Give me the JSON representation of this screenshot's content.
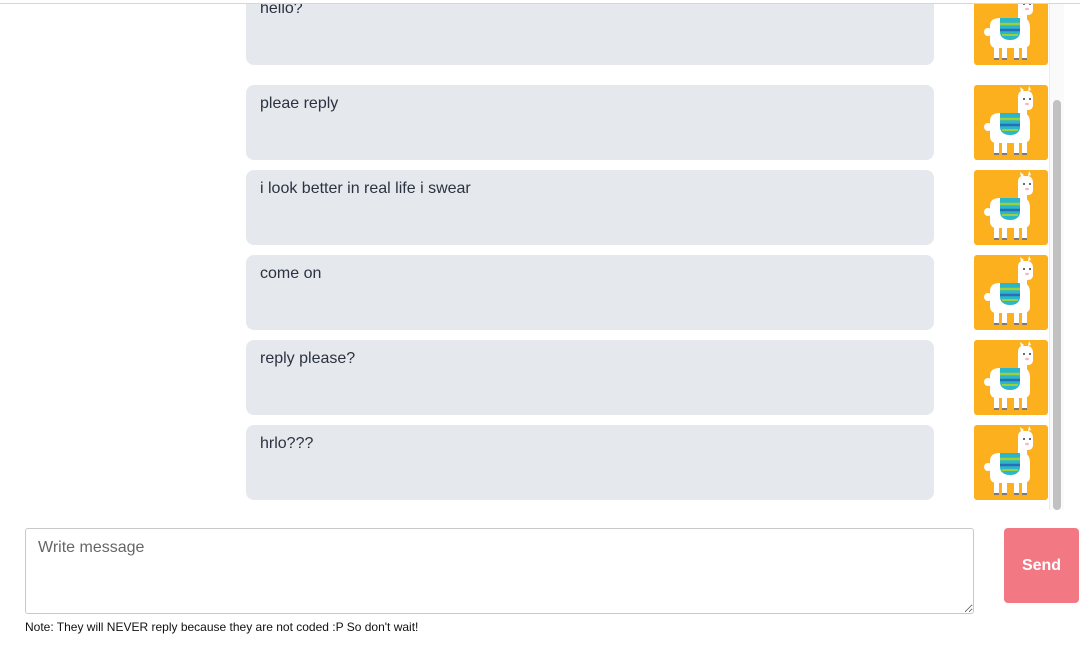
{
  "messages": [
    {
      "text": "hello?",
      "avatar": "llama-icon"
    },
    {
      "text": "pleae reply",
      "avatar": "llama-icon"
    },
    {
      "text": "i look better in real life i swear",
      "avatar": "llama-icon"
    },
    {
      "text": "come on",
      "avatar": "llama-icon"
    },
    {
      "text": "reply please?",
      "avatar": "llama-icon"
    },
    {
      "text": "hrlo???",
      "avatar": "llama-icon"
    }
  ],
  "composer": {
    "placeholder": "Write message",
    "value": "",
    "send_label": "Send"
  },
  "note": "Note: They will NEVER reply because they are not coded :P So don't wait!",
  "colors": {
    "bubble_bg": "#e5e8ec",
    "avatar_bg": "#fdb01e",
    "send_bg": "#f27884",
    "llama_blanket_teal": "#2ab7c9",
    "llama_blanket_blue": "#2a6fb5",
    "llama_blanket_green": "#9ccf3a"
  }
}
